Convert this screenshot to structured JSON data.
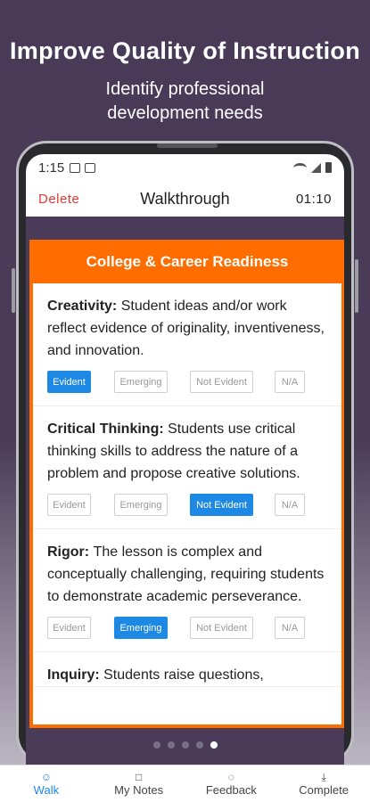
{
  "hero": {
    "title": "Improve Quality of Instruction",
    "subtitle_line1": "Identify professional",
    "subtitle_line2": "development needs"
  },
  "status_bar": {
    "time": "1:15"
  },
  "appbar": {
    "delete_label": "Delete",
    "title": "Walkthrough",
    "timer": "01:10"
  },
  "card": {
    "title": "College & Career Readiness",
    "rating_options": [
      "Evident",
      "Emerging",
      "Not Evident",
      "N/A"
    ],
    "items": [
      {
        "name": "Creativity",
        "description": "Student ideas and/or work reflect evidence of originality, inventiveness, and innovation.",
        "selected": "Evident"
      },
      {
        "name": "Critical Thinking",
        "description": "Students use critical thinking skills to address the nature of a problem and propose creative solutions.",
        "selected": "Not Evident"
      },
      {
        "name": "Rigor",
        "description": "The lesson is complex and conceptually challenging, requiring students to demonstrate academic perseverance.",
        "selected": "Emerging"
      },
      {
        "name": "Inquiry",
        "description": "Students raise questions,",
        "selected": ""
      }
    ]
  },
  "pager": {
    "count": 5,
    "active_index": 4
  },
  "bottom_nav": [
    {
      "label": "Walk",
      "icon": "person-walk-icon",
      "active": true
    },
    {
      "label": "My Notes",
      "icon": "note-icon",
      "active": false
    },
    {
      "label": "Feedback",
      "icon": "chat-icon",
      "active": false
    },
    {
      "label": "Complete",
      "icon": "download-icon",
      "active": false
    }
  ],
  "colors": {
    "accent_orange": "#ff6d00",
    "selected_blue": "#1e88e5",
    "delete_red": "#e53935",
    "background_purple": "#4a3c59"
  }
}
